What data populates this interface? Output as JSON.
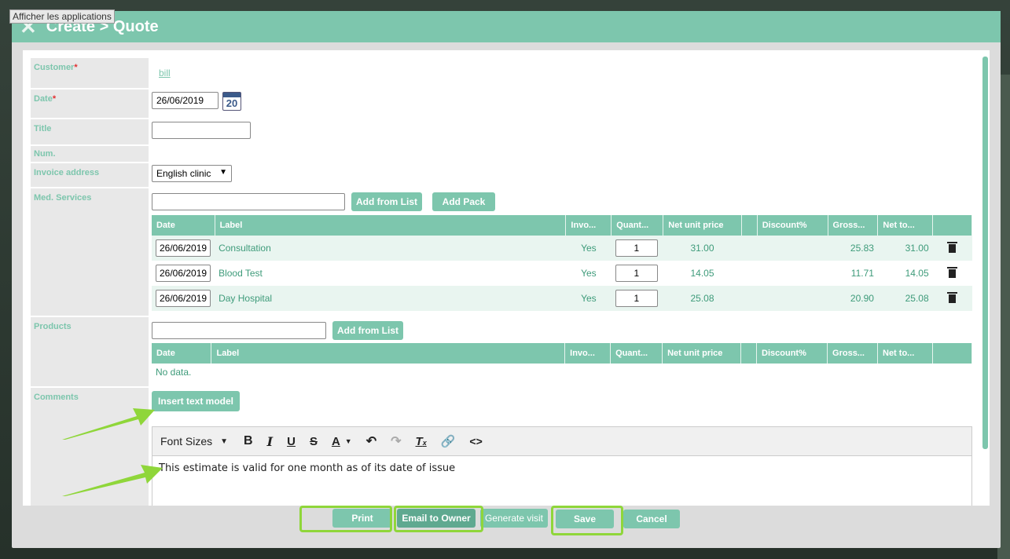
{
  "tooltip": "Afficher les applications",
  "dialog": {
    "title": "Create > Quote"
  },
  "form": {
    "customer_label": "Customer",
    "customer_value": "bill",
    "date_label": "Date",
    "date_value": "26/06/2019",
    "calendar_day": "20",
    "title_label": "Title",
    "num_label": "Num.",
    "invoice_address_label": "Invoice address",
    "invoice_address_value": "English clinic",
    "med_services_label": "Med. Services",
    "products_label": "Products",
    "comments_label": "Comments"
  },
  "buttons": {
    "add_from_list": "Add from List",
    "add_pack": "Add Pack",
    "insert_text_model": "Insert text model",
    "print": "Print",
    "email_owner": "Email to Owner",
    "generate_visit": "Generate visit",
    "save": "Save",
    "cancel": "Cancel"
  },
  "table_headers": [
    "Date",
    "Label",
    "Invo...",
    "Quant...",
    "Net unit price",
    "",
    "Discount%",
    "Gross...",
    "Net to...",
    ""
  ],
  "services": [
    {
      "date": "26/06/2019",
      "label": "Consultation",
      "invoiced": "Yes",
      "qty": "1",
      "net_unit": "31.00",
      "gross": "25.83",
      "net_total": "31.00"
    },
    {
      "date": "26/06/2019",
      "label": "Blood Test",
      "invoiced": "Yes",
      "qty": "1",
      "net_unit": "14.05",
      "gross": "11.71",
      "net_total": "14.05"
    },
    {
      "date": "26/06/2019",
      "label": "Day Hospital",
      "invoiced": "Yes",
      "qty": "1",
      "net_unit": "25.08",
      "gross": "20.90",
      "net_total": "25.08"
    }
  ],
  "products_empty": "No data.",
  "editor": {
    "font_sizes": "Font Sizes",
    "text": "This estimate is valid for one month as of its date of issue"
  },
  "colors": {
    "accent": "#7dc6ad",
    "highlight": "#8fd63a",
    "required": "#e03030"
  }
}
